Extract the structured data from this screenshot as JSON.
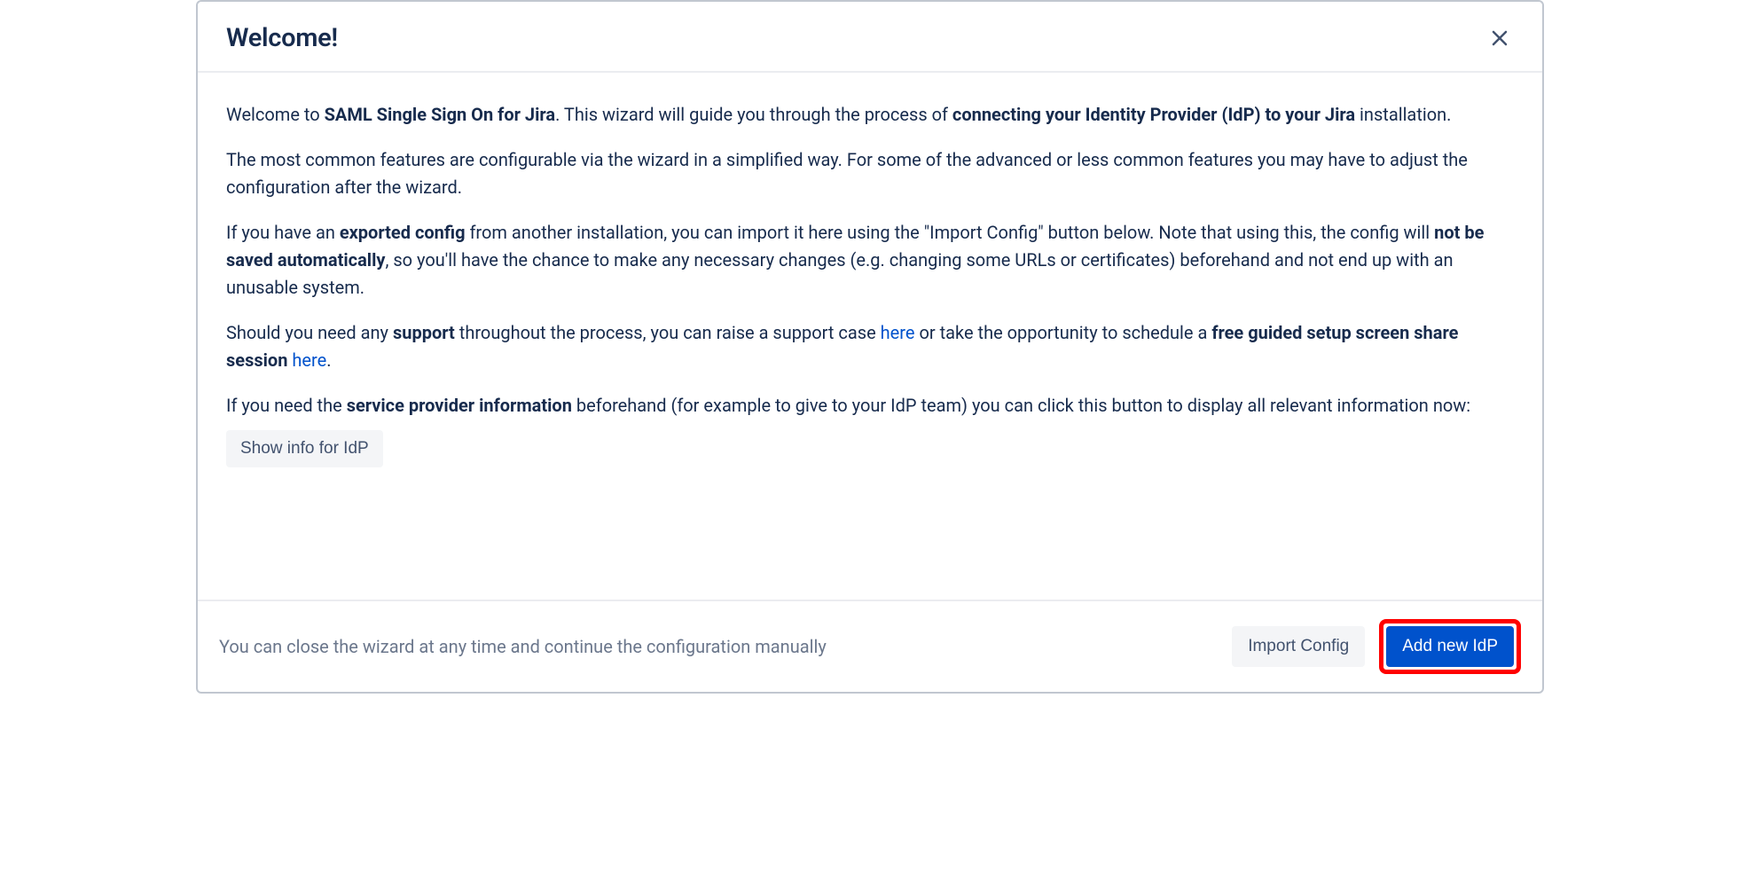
{
  "header": {
    "title": "Welcome!"
  },
  "body": {
    "p1": {
      "t1": "Welcome to ",
      "b1": "SAML Single Sign On for Jira",
      "t2": ". This wizard will guide you through the process of ",
      "b2": "connecting your Identity Provider (IdP) to your Jira",
      "t3": " installation."
    },
    "p2": "The most common features are configurable via the wizard in a simplified way. For some of the advanced or less common features you may have to adjust the configuration after the wizard.",
    "p3": {
      "t1": "If you have an ",
      "b1": "exported config",
      "t2": " from another installation, you can import it here using the \"Import Config\" button below. Note that using this, the config will ",
      "b2": "not be saved automatically",
      "t3": ", so you'll have the chance to make any necessary changes (e.g. changing some URLs or certificates) beforehand and not end up with an unusable system."
    },
    "p4": {
      "t1": "Should you need any ",
      "b1": "support",
      "t2": " throughout the process, you can raise a support case ",
      "link1": "here",
      "t3": " or take the opportunity to schedule a ",
      "b2": "free guided setup screen share session",
      "t4": " ",
      "link2": "here",
      "t5": "."
    },
    "p5": {
      "t1": "If you need the ",
      "b1": "service provider information",
      "t2": " beforehand (for example to give to your IdP team) you can click this button to display all relevant information now:"
    },
    "show_info_btn": "Show info for IdP"
  },
  "footer": {
    "hint": "You can close the wizard at any time and continue the configuration manually",
    "import_btn": "Import Config",
    "add_btn": "Add new IdP"
  }
}
